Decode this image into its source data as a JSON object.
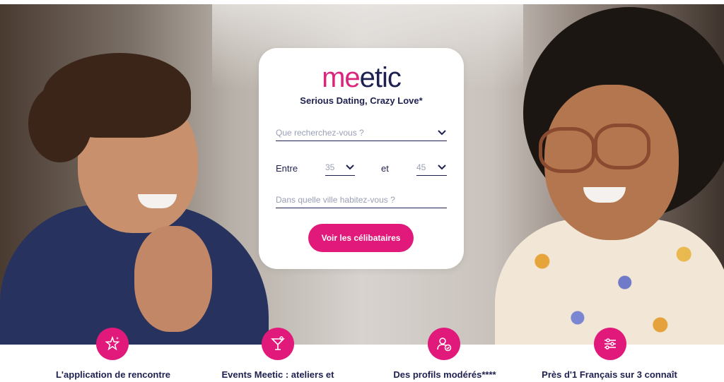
{
  "brand": {
    "logo_part1": "me",
    "logo_part2": "etic",
    "tagline": "Serious Dating, Crazy Love*",
    "colors": {
      "pink": "#e0197b",
      "navy": "#1e2150"
    }
  },
  "form": {
    "looking_for_placeholder": "Que recherchez-vous ?",
    "between_label": "Entre",
    "age_min": "35",
    "and_label": "et",
    "age_max": "45",
    "city_placeholder": "Dans quelle ville habitez-vous ?",
    "submit_label": "Voir les célibataires"
  },
  "features": [
    {
      "icon": "stars-icon",
      "text": "L'application de rencontre"
    },
    {
      "icon": "cocktail-icon",
      "text": "Events Meetic : ateliers et"
    },
    {
      "icon": "verified-profile-icon",
      "text": "Des profils modérés****"
    },
    {
      "icon": "sliders-icon",
      "text": "Près d'1 Français sur 3 connaît"
    }
  ]
}
